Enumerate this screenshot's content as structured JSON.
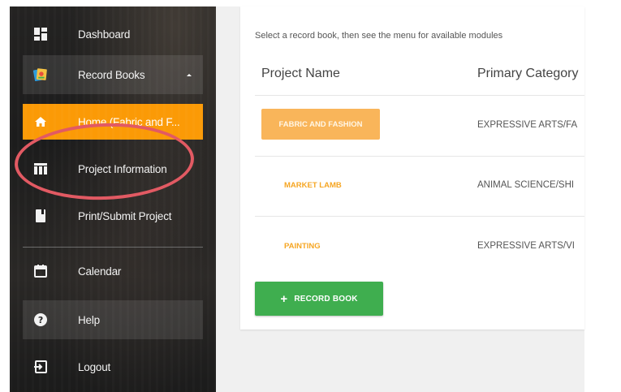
{
  "sidebar": {
    "items": [
      {
        "label": "Dashboard",
        "icon": "dashboard-icon"
      },
      {
        "label": "Record Books",
        "icon": "record-books-icon"
      },
      {
        "label": "Home (Fabric and F...",
        "icon": "home-icon"
      },
      {
        "label": "Project Information",
        "icon": "table-icon"
      },
      {
        "label": "Print/Submit Project",
        "icon": "book-icon"
      },
      {
        "label": "Calendar",
        "icon": "calendar-icon"
      },
      {
        "label": "Help",
        "icon": "help-icon"
      },
      {
        "label": "Logout",
        "icon": "logout-icon"
      }
    ]
  },
  "main": {
    "hint": "Select a record book, then see the menu for available modules",
    "columns": [
      "Project Name",
      "Primary Category"
    ],
    "rows": [
      {
        "name": "FABRIC AND FASHION",
        "category": "EXPRESSIVE ARTS/FA"
      },
      {
        "name": "MARKET LAMB",
        "category": "ANIMAL SCIENCE/SHI"
      },
      {
        "name": "PAINTING",
        "category": "EXPRESSIVE ARTS/VI"
      }
    ],
    "add_button": {
      "plus": "+",
      "label": "RECORD BOOK"
    }
  },
  "colors": {
    "accent_orange": "#fb9a06",
    "pill_orange": "#f9b55a",
    "link_orange": "#f6a623",
    "button_green": "#3fae4f",
    "annotation_red": "#e25a63"
  }
}
